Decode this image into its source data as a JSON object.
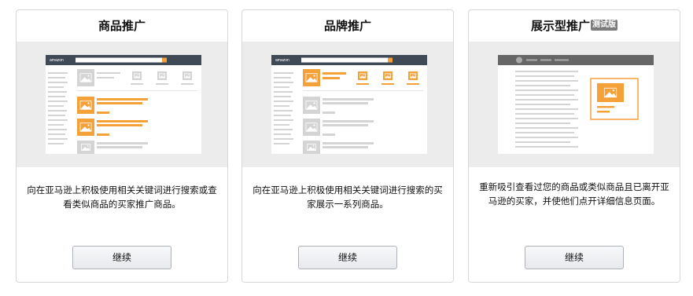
{
  "cards": [
    {
      "title": "商品推广",
      "description": "向在亚马逊上积极使用相关关键词进行搜索或查看类似商品的买家推广商品。",
      "button_label": "继续"
    },
    {
      "title": "品牌推广",
      "description": "向在亚马逊上积极使用相关关键词进行搜索的买家展示一系列商品。",
      "button_label": "继续"
    },
    {
      "title": "展示型推广",
      "badge": "测试版",
      "description": "重新吸引查看过您的商品或类似商品且已离开亚马逊的买家，并使他们点开详细信息页面。",
      "button_label": "继续"
    }
  ],
  "illustration": {
    "logo_text": "amazon",
    "accent_color": "#f5a13a",
    "header_color": "#404a56",
    "placeholder_color": "#d4d4d4"
  }
}
